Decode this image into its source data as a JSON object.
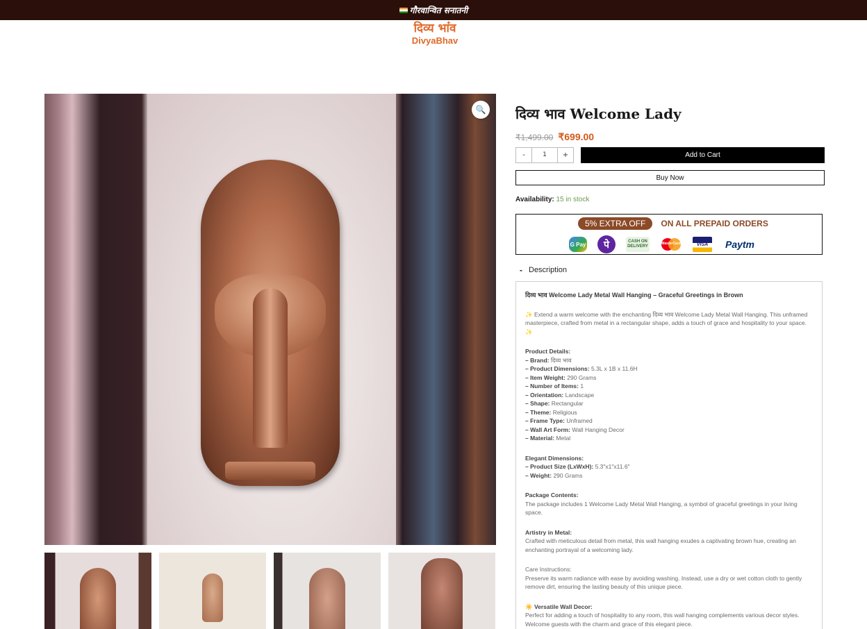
{
  "topbar": {
    "announcement": "गौरवान्वित सनातनी"
  },
  "logo": {
    "hindi": "दिव्य भाव",
    "english": "DivyaBhav"
  },
  "product": {
    "title": "दिव्य भाव Welcome Lady",
    "price_old": "₹1,499.00",
    "price_new": "₹699.00",
    "quantity": "1",
    "qty_minus": "-",
    "qty_plus": "+",
    "add_to_cart": "Add to Cart",
    "buy_now": "Buy Now",
    "availability_label": "Availability:",
    "availability_value": "15 in stock"
  },
  "offer": {
    "pill": "5% EXTRA OFF",
    "text": "ON ALL PREPAID ORDERS",
    "methods": [
      {
        "name": "gpay-icon",
        "label": "G Pay"
      },
      {
        "name": "phonepe-icon",
        "label": "पे"
      },
      {
        "name": "cod-icon",
        "label": "CASH ON DELIVERY"
      },
      {
        "name": "mastercard-icon",
        "label": "MasterCard"
      },
      {
        "name": "visa-icon",
        "label": "VISA"
      },
      {
        "name": "paytm-icon",
        "label": "Paytm"
      }
    ]
  },
  "description": {
    "toggle_icon": "-",
    "toggle_label": "Description",
    "heading": "दिव्य भाव Welcome Lady Metal Wall Hanging – Graceful Greetings in Brown",
    "intro": "✨ Extend a warm welcome with the enchanting दिव्य भाव Welcome Lady Metal Wall Hanging. This unframed masterpiece, crafted from metal in a rectangular shape, adds a touch of grace and hospitality to your space. ✨",
    "details_title": "Product Details:",
    "details": [
      {
        "key": "– Brand:",
        "value": " दिव्य भाव"
      },
      {
        "key": "– Product Dimensions:",
        "value": " 5.3L x 1B x 11.6H"
      },
      {
        "key": "– Item Weight:",
        "value": " 290 Grams"
      },
      {
        "key": "– Number of Items:",
        "value": " 1"
      },
      {
        "key": "– Orientation:",
        "value": " Landscape"
      },
      {
        "key": "– Shape:",
        "value": " Rectangular"
      },
      {
        "key": "– Theme:",
        "value": " Religious"
      },
      {
        "key": "– Frame Type:",
        "value": " Unframed"
      },
      {
        "key": "– Wall Art Form:",
        "value": " Wall Hanging Decor"
      },
      {
        "key": "– Material:",
        "value": " Metal"
      }
    ],
    "dimensions_title": "Elegant Dimensions:",
    "dimensions": [
      {
        "key": "– Product Size (LxWxH):",
        "value": " 5.3\"x1\"x11.6\""
      },
      {
        "key": "– Weight:",
        "value": " 290 Grams"
      }
    ],
    "package_title": "Package Contents:",
    "package_text": "The package includes 1 Welcome Lady Metal Wall Hanging, a symbol of graceful greetings in your living space.",
    "artistry_title": "Artistry in Metal:",
    "artistry_text": "Crafted with meticulous detail from metal, this wall hanging exudes a captivating brown hue, creating an enchanting portrayal of a welcoming lady.",
    "care_title": "Care Instructions:",
    "care_text": "Preserve its warm radiance with ease by avoiding washing. Instead, use a dry or wet cotton cloth to gently remove dirt, ensuring the lasting beauty of this unique piece.",
    "decor_title": "☀️ Versatile Wall Decor:",
    "decor_text": "Perfect for adding a touch of hospitality to any room, this wall hanging complements various decor styles. Welcome guests with the charm and grace of this elegant piece."
  }
}
